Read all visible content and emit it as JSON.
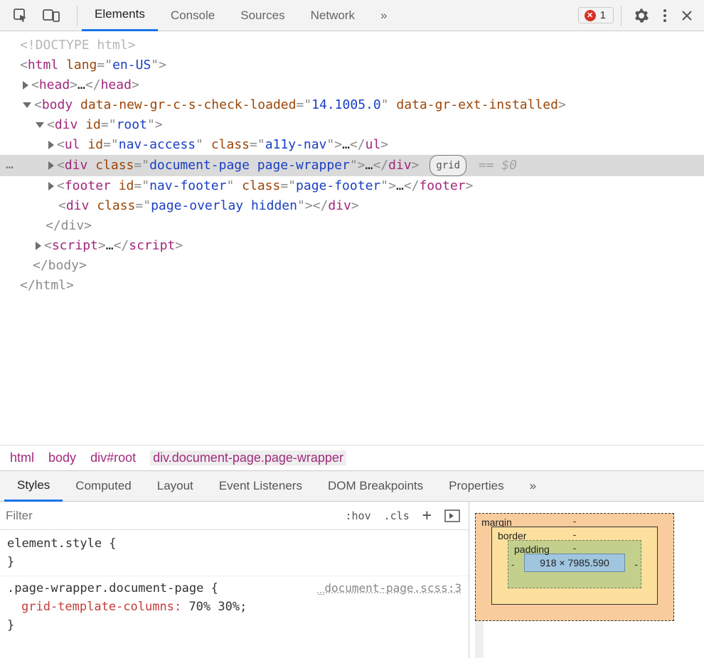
{
  "toolbar": {
    "tabs": [
      "Elements",
      "Console",
      "Sources",
      "Network"
    ],
    "more": "»",
    "error_count": "1"
  },
  "dom": {
    "doctype": "<!DOCTYPE html>",
    "html_open": {
      "tag": "html",
      "attrs": [
        [
          "lang",
          "en-US"
        ]
      ]
    },
    "head": {
      "tag": "head",
      "ellipsis": "…"
    },
    "body_open": {
      "tag": "body",
      "attrs": [
        [
          "data-new-gr-c-s-check-loaded",
          "14.1005.0"
        ],
        [
          "data-gr-ext-installed",
          ""
        ]
      ]
    },
    "root_open": {
      "tag": "div",
      "attrs": [
        [
          "id",
          "root"
        ]
      ]
    },
    "nav_ul": {
      "tag": "ul",
      "attrs": [
        [
          "id",
          "nav-access"
        ],
        [
          "class",
          "a11y-nav"
        ]
      ],
      "ellipsis": "…"
    },
    "selected": {
      "tag": "div",
      "attrs": [
        [
          "class",
          "document-page page-wrapper"
        ]
      ],
      "ellipsis": "…",
      "badge": "grid",
      "eq": "== $0"
    },
    "footer": {
      "tag": "footer",
      "attrs": [
        [
          "id",
          "nav-footer"
        ],
        [
          "class",
          "page-footer"
        ]
      ],
      "ellipsis": "…"
    },
    "overlay": {
      "tag": "div",
      "attrs": [
        [
          "class",
          "page-overlay hidden"
        ]
      ]
    },
    "root_close": "</div>",
    "script": {
      "tag": "script",
      "ellipsis": "…"
    },
    "body_close": "</body>",
    "html_close": "</html>"
  },
  "breadcrumb": [
    "html",
    "body",
    "div#root",
    "div.document-page.page-wrapper"
  ],
  "lower_tabs": [
    "Styles",
    "Computed",
    "Layout",
    "Event Listeners",
    "DOM Breakpoints",
    "Properties"
  ],
  "filter": {
    "placeholder": "Filter",
    "hov": ":hov",
    "cls": ".cls",
    "plus": "+"
  },
  "styles": {
    "element_style": "element.style {",
    "closing": "}",
    "rule_selector": ".page-wrapper.document-page {",
    "rule_source": "_document-page.scss:3",
    "prop_name": "grid-template-columns",
    "prop_val": "70% 30%;"
  },
  "box_model": {
    "margin_label": "margin",
    "border_label": "border",
    "padding_label": "padding",
    "content": "918 × 7985.590",
    "dash": "-"
  }
}
